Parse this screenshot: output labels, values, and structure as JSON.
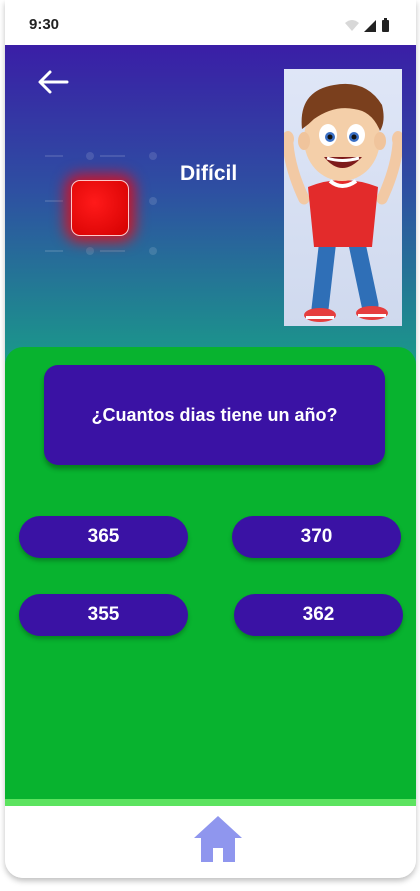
{
  "status_bar": {
    "time": "9:30"
  },
  "header": {
    "difficulty": "Difícil"
  },
  "question": {
    "text": "¿Cuantos dias tiene un año?"
  },
  "answers": [
    "365",
    "370",
    "355",
    "362"
  ],
  "colors": {
    "header_top": "#3a1ea6",
    "header_bottom": "#1a9a8a",
    "content_bg": "#08b32f",
    "card_bg": "#3a12a4",
    "difficulty_indicator": "#ff1a1a",
    "bottom_accent": "#5ce35f",
    "home_icon": "#8f96ee"
  },
  "icons": {
    "back": "arrow-left-icon",
    "home": "home-icon",
    "wifi": "wifi-icon",
    "signal": "signal-icon",
    "battery": "battery-icon"
  }
}
